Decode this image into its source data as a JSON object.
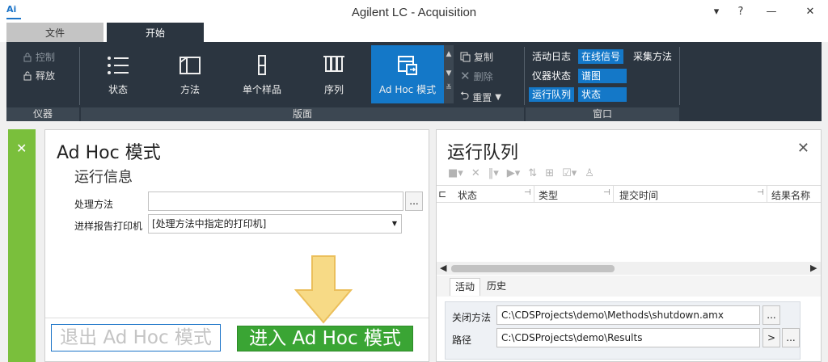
{
  "window": {
    "logo_text": "Ai",
    "title": "Agilent LC - Acquisition",
    "controls": {
      "pin": "▾",
      "help": "?",
      "minimize": "—",
      "close": "✕"
    }
  },
  "tabs": {
    "file": "文件",
    "start": "开始"
  },
  "ribbon": {
    "instrument": {
      "control": "控制",
      "release": "释放",
      "group_label": "仪器"
    },
    "layout": {
      "status": "状态",
      "method": "方法",
      "single_sample": "单个样品",
      "sequence": "序列",
      "adhoc": "Ad Hoc 模式",
      "group_label": "版面"
    },
    "edit": {
      "copy": "复制",
      "delete": "删除",
      "reset": "重置"
    },
    "window": {
      "activity_log": "活动日志",
      "online_signal": "在线信号",
      "acquire_method": "采集方法",
      "instrument_status": "仪器状态",
      "spectrum": "谱图",
      "run_queue": "运行队列",
      "status": "状态",
      "group_label": "窗口"
    }
  },
  "adhoc_panel": {
    "title": "Ad Hoc 模式",
    "section": "运行信息",
    "processing_method_label": "处理方法",
    "processing_method_value": "",
    "printer_label": "进样报告打印机",
    "printer_value": "[处理方法中指定的打印机]",
    "browse": "...",
    "exit_button": "退出 Ad Hoc 模式",
    "enter_button": "进入 Ad Hoc 模式"
  },
  "queue_panel": {
    "title": "运行队列",
    "columns": [
      "状态",
      "类型",
      "提交时间",
      "结果名称"
    ],
    "subtabs": {
      "active": "活动",
      "history": "历史"
    },
    "shutdown_label": "关闭方法",
    "shutdown_value": "C:\\CDSProjects\\demo\\Methods\\shutdown.amx",
    "path_label": "路径",
    "path_value": "C:\\CDSProjects\\demo\\Results",
    "browse": "...",
    "go": ">"
  },
  "colors": {
    "ribbon_bg": "#2b3540",
    "accent_blue": "#1478c8",
    "enter_green": "#3aa534",
    "left_bar_green": "#7abf3c",
    "arrow_yellow": "#f7d77a"
  }
}
